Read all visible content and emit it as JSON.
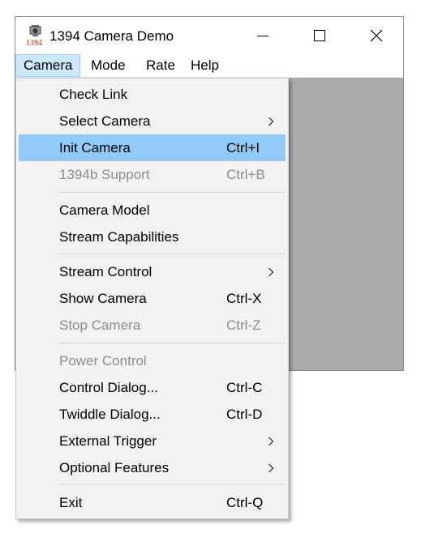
{
  "window": {
    "title": "1394 Camera Demo"
  },
  "app_icon": {
    "text": "1394",
    "name": "camera-app-icon"
  },
  "title_buttons": [
    "minimize",
    "maximize",
    "close"
  ],
  "menubar": {
    "items": [
      "Camera",
      "Mode",
      "Rate",
      "Help"
    ],
    "active": "Camera"
  },
  "camera_menu": {
    "items": [
      {
        "label": "Check Link",
        "shortcut": "",
        "submenu": false,
        "enabled": true,
        "highlighted": false
      },
      {
        "label": "Select Camera",
        "shortcut": "",
        "submenu": true,
        "enabled": true,
        "highlighted": false
      },
      {
        "label": "Init Camera",
        "shortcut": "Ctrl+I",
        "submenu": false,
        "enabled": true,
        "highlighted": true
      },
      {
        "label": "1394b Support",
        "shortcut": "Ctrl+B",
        "submenu": false,
        "enabled": false,
        "highlighted": false
      },
      {
        "label": "Camera Model",
        "shortcut": "",
        "submenu": false,
        "enabled": true,
        "highlighted": false
      },
      {
        "label": "Stream Capabilities",
        "shortcut": "",
        "submenu": false,
        "enabled": true,
        "highlighted": false
      },
      {
        "label": "Stream Control",
        "shortcut": "",
        "submenu": true,
        "enabled": true,
        "highlighted": false
      },
      {
        "label": "Show Camera",
        "shortcut": "Ctrl-X",
        "submenu": false,
        "enabled": true,
        "highlighted": false
      },
      {
        "label": "Stop Camera",
        "shortcut": "Ctrl-Z",
        "submenu": false,
        "enabled": false,
        "highlighted": false
      },
      {
        "label": "Power Control",
        "shortcut": "",
        "submenu": false,
        "enabled": false,
        "highlighted": false
      },
      {
        "label": "Control Dialog...",
        "shortcut": "Ctrl-C",
        "submenu": false,
        "enabled": true,
        "highlighted": false
      },
      {
        "label": "Twiddle Dialog...",
        "shortcut": "Ctrl-D",
        "submenu": false,
        "enabled": true,
        "highlighted": false
      },
      {
        "label": "External Trigger",
        "shortcut": "",
        "submenu": true,
        "enabled": true,
        "highlighted": false
      },
      {
        "label": "Optional Features",
        "shortcut": "",
        "submenu": true,
        "enabled": true,
        "highlighted": false
      },
      {
        "label": "Exit",
        "shortcut": "Ctrl-Q",
        "submenu": false,
        "enabled": true,
        "highlighted": false
      }
    ]
  },
  "colors": {
    "highlight": "#91c9f7",
    "menubar_active": "#cce8ff",
    "client_area": "#ababab",
    "disabled_text": "#8d8d8d",
    "menu_background": "#f2f2f2"
  }
}
